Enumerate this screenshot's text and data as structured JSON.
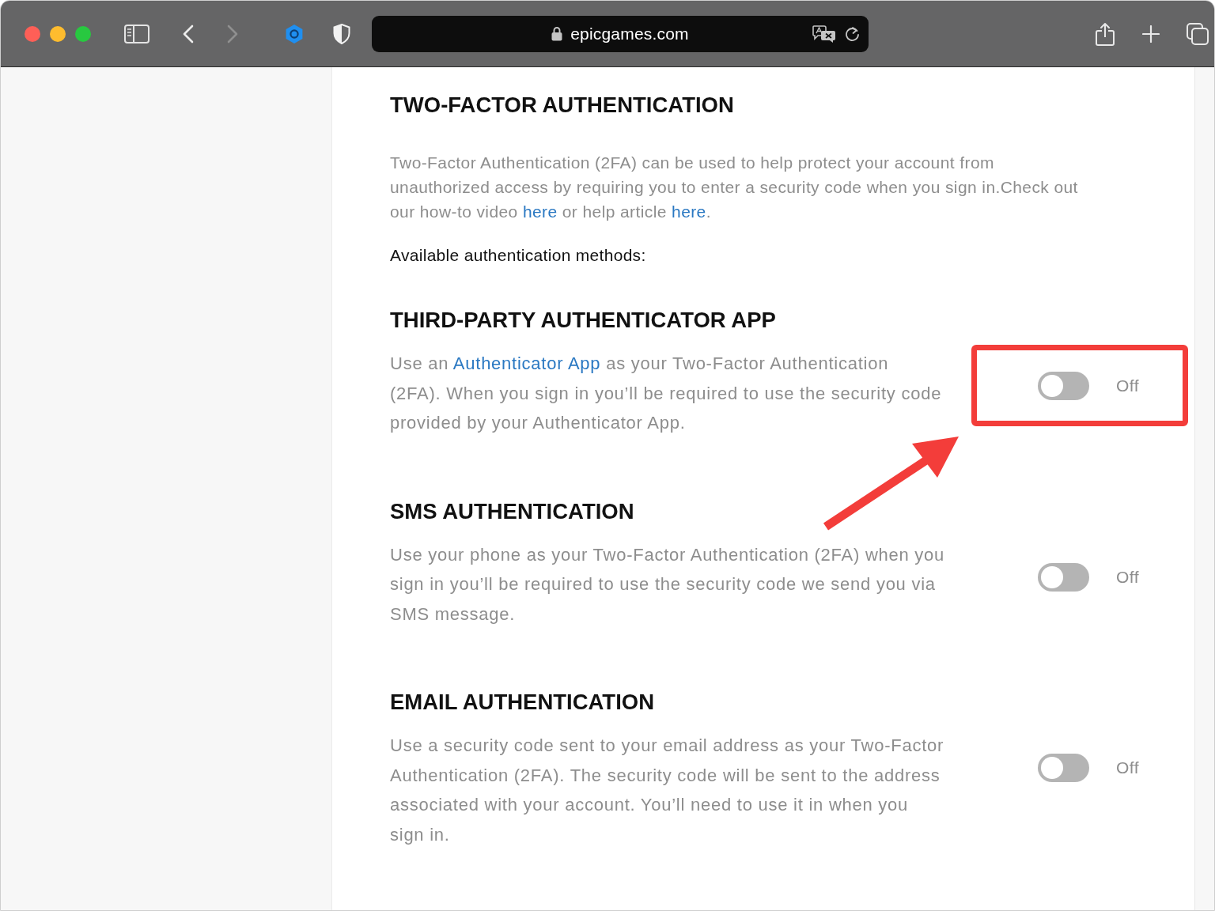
{
  "browser": {
    "address": "epicgames.com",
    "back_enabled": true,
    "forward_enabled": false
  },
  "page": {
    "title": "TWO-FACTOR AUTHENTICATION",
    "intro_lines": [
      [
        {
          "kind": "text",
          "text": "Two-Factor Authentication (2FA) can be used to help protect your account from"
        }
      ],
      [
        {
          "kind": "text",
          "text": "unauthorized access by requiring you to enter a security code when you sign in.Check out"
        }
      ],
      [
        {
          "kind": "text",
          "text": "our how-to video "
        },
        {
          "kind": "link",
          "text": "here"
        },
        {
          "kind": "text",
          "text": " or help article "
        },
        {
          "kind": "link",
          "text": "here"
        },
        {
          "kind": "text",
          "text": "."
        }
      ]
    ],
    "methods_label": "Available authentication methods:",
    "methods": [
      {
        "title": "THIRD-PARTY AUTHENTICATOR APP",
        "description_lines": [
          [
            {
              "kind": "text",
              "text": "Use an "
            },
            {
              "kind": "link",
              "text": "Authenticator App"
            },
            {
              "kind": "text",
              "text": " as your Two-Factor Authentication"
            }
          ],
          [
            {
              "kind": "text",
              "text": "(2FA). When you sign in you’ll be required to use the security code"
            }
          ],
          [
            {
              "kind": "text",
              "text": "provided by your Authenticator App."
            }
          ]
        ],
        "on": false,
        "state_label": "Off",
        "highlighted": true
      },
      {
        "title": "SMS AUTHENTICATION",
        "description_lines": [
          [
            {
              "kind": "text",
              "text": "Use your phone as your Two-Factor Authentication (2FA) when you"
            }
          ],
          [
            {
              "kind": "text",
              "text": "sign in you’ll be required to use the security code we send you via"
            }
          ],
          [
            {
              "kind": "text",
              "text": "SMS message."
            }
          ]
        ],
        "on": false,
        "state_label": "Off",
        "highlighted": false
      },
      {
        "title": "EMAIL AUTHENTICATION",
        "description_lines": [
          [
            {
              "kind": "text",
              "text": "Use a security code sent to your email address as your Two-Factor"
            }
          ],
          [
            {
              "kind": "text",
              "text": "Authentication (2FA). The security code will be sent to the address"
            }
          ],
          [
            {
              "kind": "text",
              "text": "associated with your account. You’ll need to use it in when you"
            }
          ],
          [
            {
              "kind": "text",
              "text": "sign in."
            }
          ]
        ],
        "on": false,
        "state_label": "Off",
        "highlighted": false
      }
    ]
  }
}
